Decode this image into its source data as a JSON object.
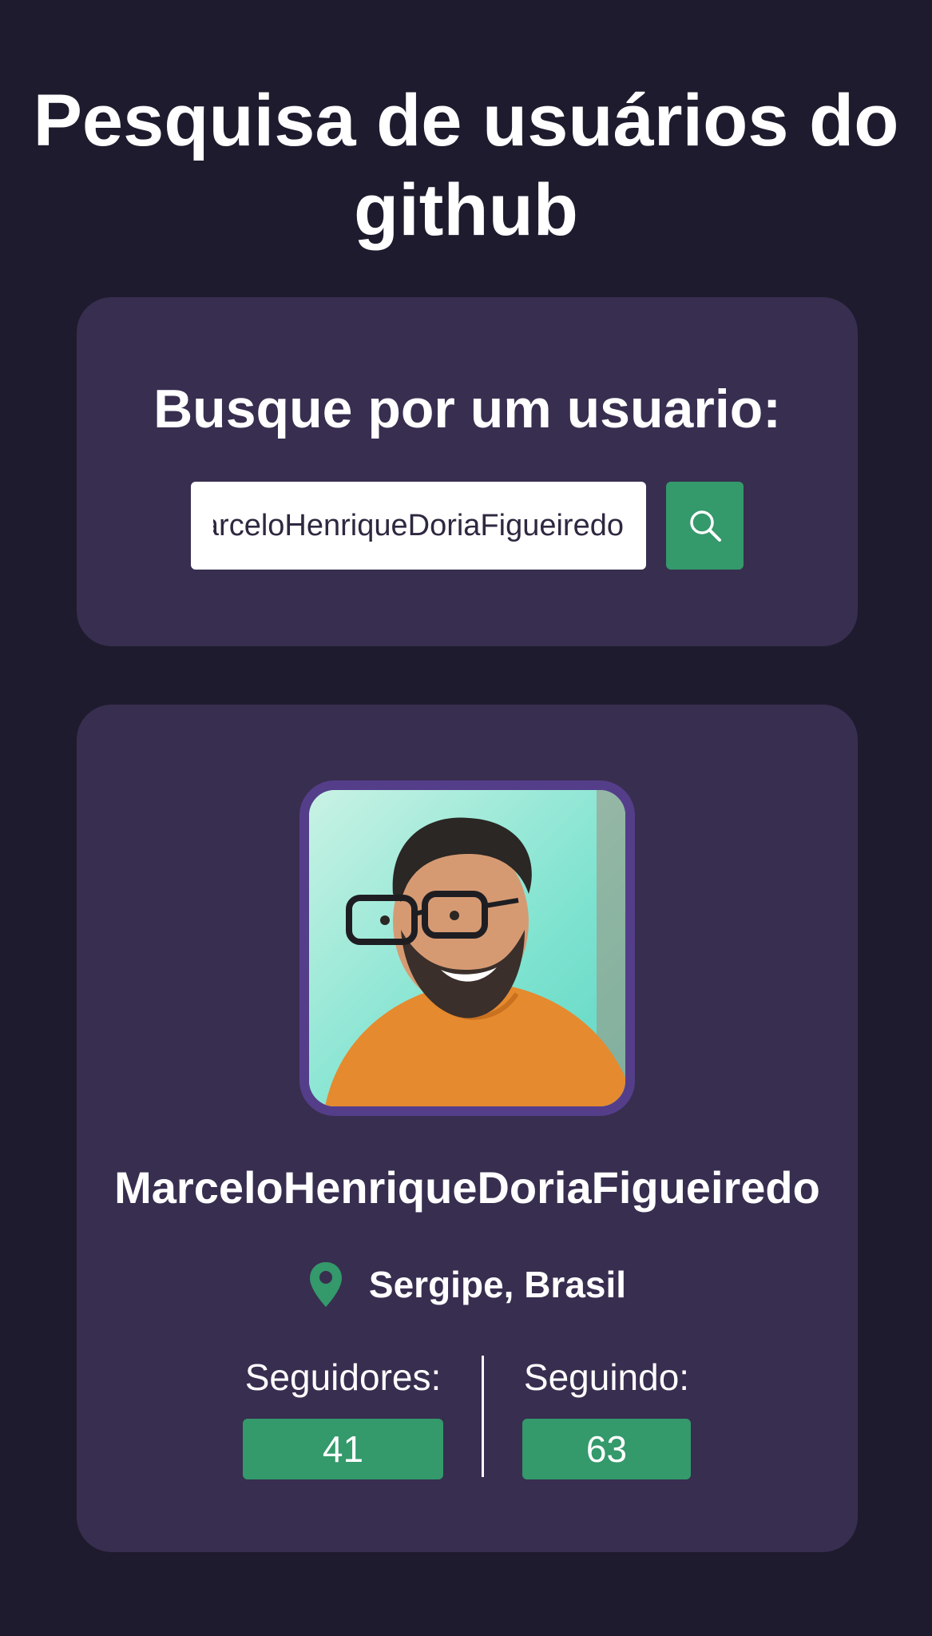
{
  "header": {
    "title": "Pesquisa de usuários do github"
  },
  "search": {
    "heading": "Busque por um usuario:",
    "input_value": "MarceloHenriqueDoriaFigueiredo",
    "button_icon": "search-icon"
  },
  "profile": {
    "username": "MarceloHenriqueDoriaFigueiredo",
    "location": "Sergipe, Brasil",
    "location_icon": "map-pin-icon",
    "followers_label": "Seguidores:",
    "followers_count": "41",
    "following_label": "Seguindo:",
    "following_count": "63"
  },
  "colors": {
    "background": "#1f1b2e",
    "card": "#382e50",
    "accent_green": "#34996b",
    "avatar_border": "#543e8a"
  }
}
